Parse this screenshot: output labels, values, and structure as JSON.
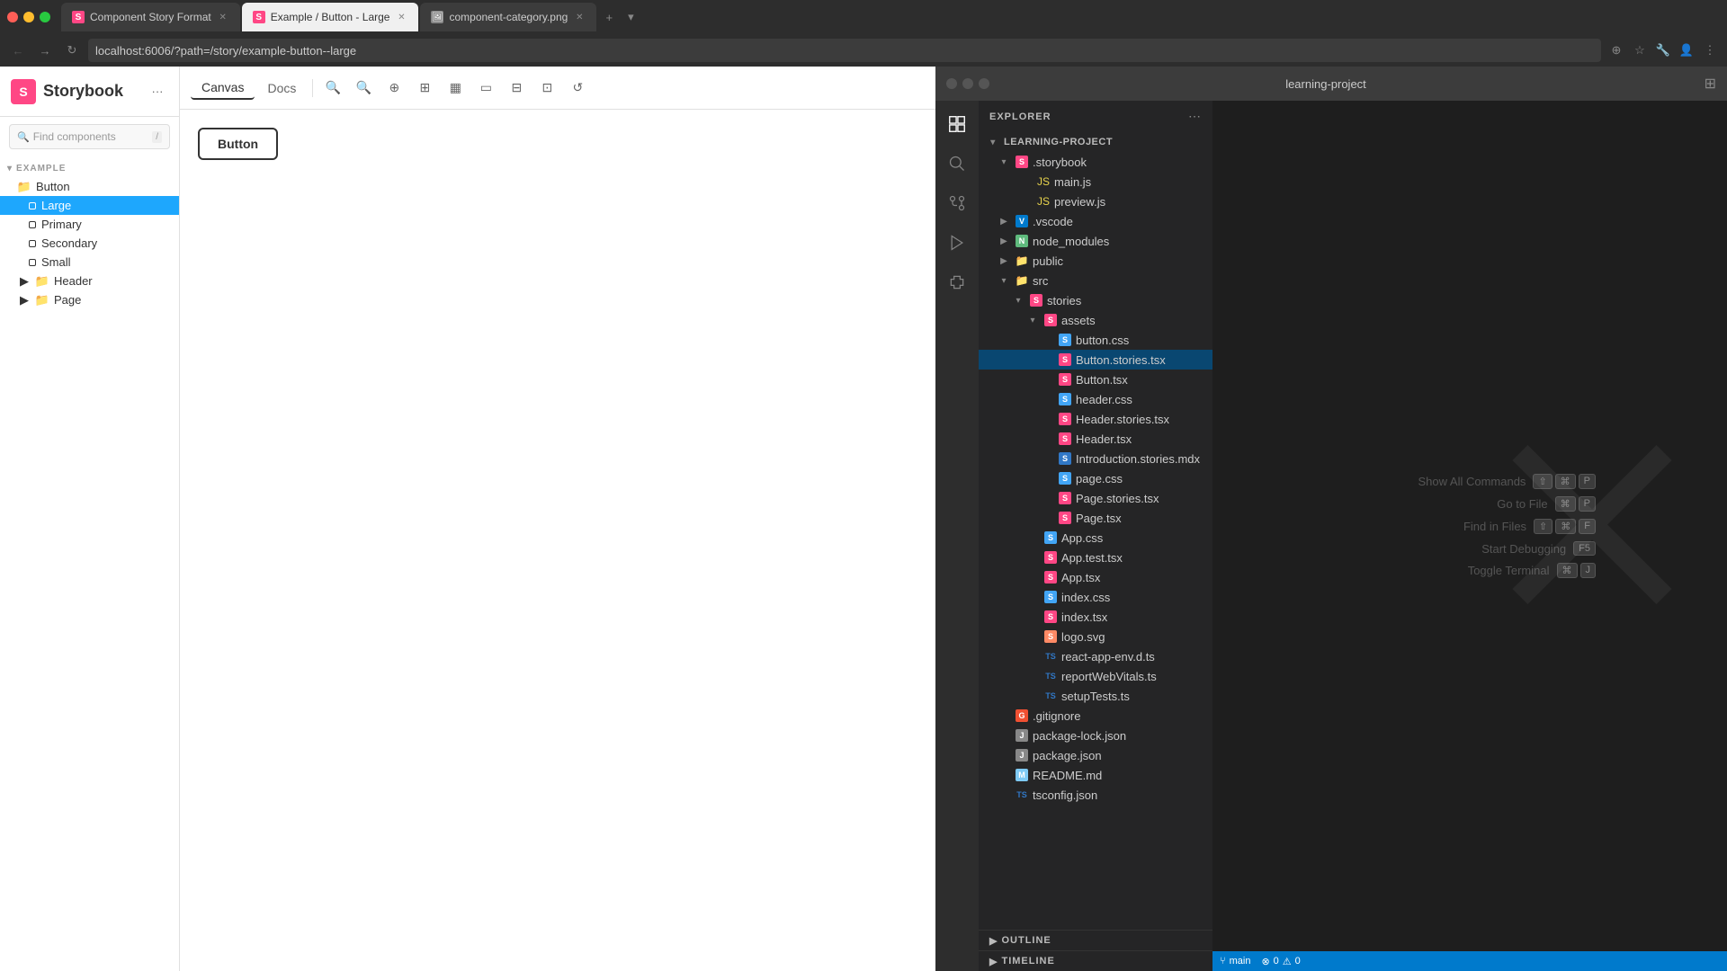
{
  "browser": {
    "tabs": [
      {
        "id": "csf",
        "label": "Component Story Format",
        "icon": "sb",
        "active": false,
        "closeable": true
      },
      {
        "id": "example",
        "label": "Example / Button - Large",
        "icon": "ex",
        "active": true,
        "closeable": true
      },
      {
        "id": "component-category",
        "label": "component-category.png",
        "icon": "img",
        "active": false,
        "closeable": true
      }
    ],
    "address": "localhost:6006/?path=/story/example-button--large"
  },
  "storybook": {
    "title": "Storybook",
    "search_placeholder": "Find components",
    "search_shortcut": "/",
    "section": "EXAMPLE",
    "tree": {
      "button": {
        "label": "Button",
        "children": [
          {
            "label": "Large",
            "selected": true
          },
          {
            "label": "Primary",
            "selected": false
          },
          {
            "label": "Secondary",
            "selected": false
          },
          {
            "label": "Small",
            "selected": false
          }
        ]
      },
      "header": {
        "label": "Header"
      },
      "page": {
        "label": "Page"
      }
    },
    "tabs": [
      "Canvas",
      "Docs"
    ],
    "active_tab": "Canvas",
    "preview_button_label": "Button"
  },
  "vscode": {
    "window_title": "learning-project",
    "explorer_title": "EXPLORER",
    "project_name": "LEARNING-PROJECT",
    "file_tree": [
      {
        "id": "storybook-folder",
        "label": ".storybook",
        "type": "folder",
        "indent": 0,
        "expanded": true
      },
      {
        "id": "main-js",
        "label": "main.js",
        "type": "js",
        "indent": 1
      },
      {
        "id": "preview-js",
        "label": "preview.js",
        "type": "js",
        "indent": 1
      },
      {
        "id": "vscode-folder",
        "label": ".vscode",
        "type": "folder-vscode",
        "indent": 0,
        "expanded": false
      },
      {
        "id": "node-modules",
        "label": "node_modules",
        "type": "folder-node",
        "indent": 0,
        "expanded": false
      },
      {
        "id": "public",
        "label": "public",
        "type": "folder-public",
        "indent": 0,
        "expanded": false
      },
      {
        "id": "src",
        "label": "src",
        "type": "folder",
        "indent": 0,
        "expanded": true
      },
      {
        "id": "stories-folder",
        "label": "stories",
        "type": "folder",
        "indent": 1,
        "expanded": true
      },
      {
        "id": "assets-folder",
        "label": "assets",
        "type": "folder",
        "indent": 2,
        "expanded": true
      },
      {
        "id": "button-css",
        "label": "button.css",
        "type": "css",
        "indent": 3,
        "selected": false
      },
      {
        "id": "button-stories-tsx",
        "label": "Button.stories.tsx",
        "type": "tsx-stories",
        "indent": 3,
        "selected": true
      },
      {
        "id": "button-tsx",
        "label": "Button.tsx",
        "type": "tsx",
        "indent": 3
      },
      {
        "id": "header-css",
        "label": "header.css",
        "type": "css",
        "indent": 3
      },
      {
        "id": "header-stories-tsx",
        "label": "Header.stories.tsx",
        "type": "tsx-stories",
        "indent": 3
      },
      {
        "id": "header-tsx",
        "label": "Header.tsx",
        "type": "tsx",
        "indent": 3
      },
      {
        "id": "introduction-mdx",
        "label": "Introduction.stories.mdx",
        "type": "mdx",
        "indent": 3
      },
      {
        "id": "page-css",
        "label": "page.css",
        "type": "css",
        "indent": 3
      },
      {
        "id": "page-stories-tsx",
        "label": "Page.stories.tsx",
        "type": "tsx-stories",
        "indent": 3
      },
      {
        "id": "page-tsx",
        "label": "Page.tsx",
        "type": "tsx",
        "indent": 3
      },
      {
        "id": "app-css",
        "label": "App.css",
        "type": "css",
        "indent": 2
      },
      {
        "id": "app-test-tsx",
        "label": "App.test.tsx",
        "type": "tsx",
        "indent": 2
      },
      {
        "id": "app-tsx",
        "label": "App.tsx",
        "type": "tsx",
        "indent": 2
      },
      {
        "id": "index-css",
        "label": "index.css",
        "type": "css",
        "indent": 2
      },
      {
        "id": "index-tsx",
        "label": "index.tsx",
        "type": "tsx",
        "indent": 2
      },
      {
        "id": "logo-svg",
        "label": "logo.svg",
        "type": "svg",
        "indent": 2
      },
      {
        "id": "react-app-env",
        "label": "react-app-env.d.ts",
        "type": "ts",
        "indent": 2
      },
      {
        "id": "report-web-vitals",
        "label": "reportWebVitals.ts",
        "type": "ts",
        "indent": 2
      },
      {
        "id": "setup-tests",
        "label": "setupTests.ts",
        "type": "ts",
        "indent": 2
      },
      {
        "id": "gitignore",
        "label": ".gitignore",
        "type": "git",
        "indent": 0
      },
      {
        "id": "package-lock",
        "label": "package-lock.json",
        "type": "json",
        "indent": 0
      },
      {
        "id": "package-json",
        "label": "package.json",
        "type": "json",
        "indent": 0
      },
      {
        "id": "readme-md",
        "label": "README.md",
        "type": "md",
        "indent": 0
      },
      {
        "id": "tsconfig-json",
        "label": "tsconfig.json",
        "type": "json-ts",
        "indent": 0
      }
    ],
    "shortcuts": [
      {
        "label": "Show All Commands",
        "keys": [
          "⇧",
          "⌘",
          "P"
        ]
      },
      {
        "label": "Go to File",
        "keys": [
          "⌘",
          "P"
        ]
      },
      {
        "label": "Find in Files",
        "keys": [
          "⇧",
          "⌘",
          "F"
        ]
      },
      {
        "label": "Start Debugging",
        "keys": [
          "F5"
        ]
      },
      {
        "label": "Toggle Terminal",
        "keys": [
          "⌘",
          "J"
        ]
      }
    ],
    "bottom_panels": [
      {
        "label": "OUTLINE"
      },
      {
        "label": "TIMELINE"
      }
    ]
  }
}
